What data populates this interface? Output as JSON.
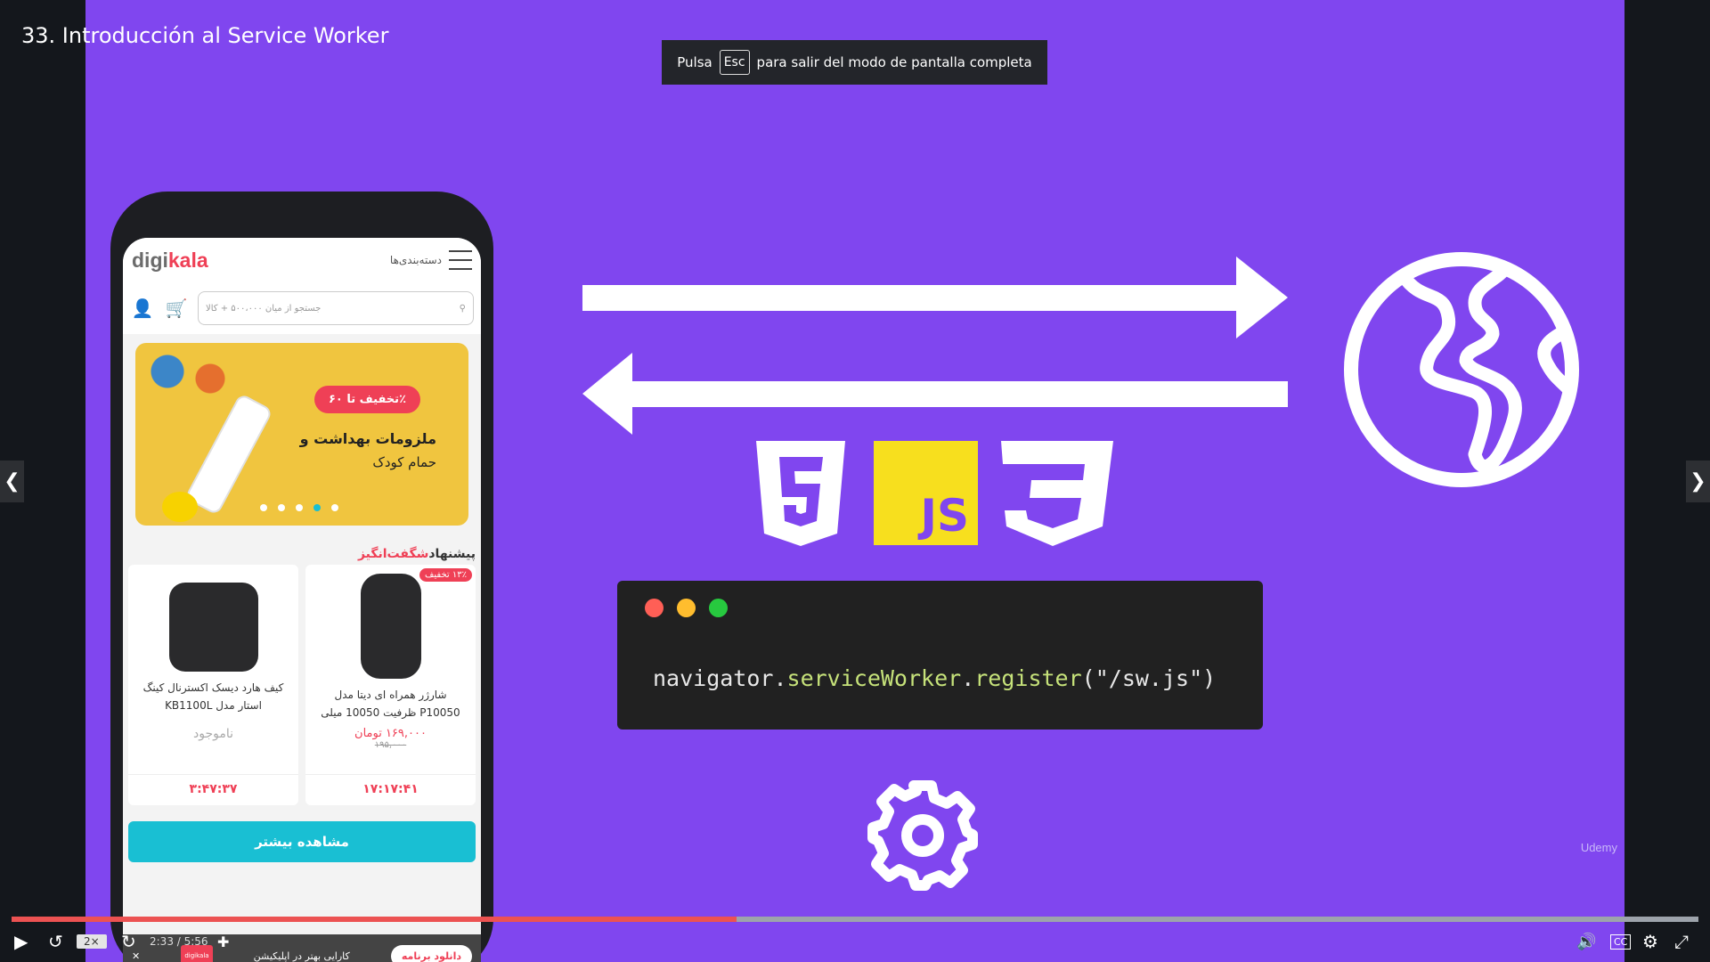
{
  "lecture": {
    "title": "33. Introducción al Service Worker"
  },
  "fullscreen_banner": {
    "pre": "Pulsa",
    "key": "Esc",
    "post": "para salir del modo de pantalla completa"
  },
  "nav": {
    "prev_icon": "chevron-left-icon",
    "next_icon": "chevron-right-icon"
  },
  "phone": {
    "logo_main": "digi",
    "logo_accent": "kala",
    "categories_label": "دسته‌بندی‌ها",
    "search_placeholder": "جستجو از میان ۵۰۰،۰۰۰ + کالا",
    "banner": {
      "badge": "تخفیف تا ۶۰٪",
      "line1": "ملزومات بهداشت و",
      "line2": "حمام کودک"
    },
    "amazing_prefix": "پیشنهاد",
    "amazing_accent": "شگفت‌انگیز",
    "products": [
      {
        "name": "شارژر همراه ای دیتا مدل P10050 ظرفیت 10050 میلی",
        "price": "۱۶۹,۰۰۰ تومان",
        "old_price": "۱۹۵,۰۰۰",
        "off": "۱۳٪ تخفیف",
        "timer": "۱۷:۱۷:۴۱"
      },
      {
        "name": "کیف هارد دیسک اکسترنال کینگ استار مدل KB1100L",
        "status": "ناموجود",
        "timer": "۳:۴۷:۳۷"
      }
    ],
    "more_button": "مشاهده بیشتر",
    "app_bar": {
      "download": "دانلود برنامه",
      "tagline": "کارایی بهتر در اپلیکیشن",
      "logo": "digikala"
    }
  },
  "diagram": {
    "code_line_prefix": "navigator.",
    "code_hl1": "serviceWorker",
    "code_mid": ".",
    "code_hl2": "register",
    "code_suffix": "(\"/sw.js\")",
    "js_label": "JS",
    "watermark": "Udemy",
    "colors": {
      "bg": "#8046ef",
      "code_bg": "#212121",
      "red": "#ff5f56",
      "yellow": "#ffbd2e",
      "green": "#27c93f",
      "highlight": "#c6e27a",
      "js": "#f7df1e"
    }
  },
  "player": {
    "progress": 0.43,
    "speed": "2×",
    "time": "2:33 / 5:56",
    "colors": {
      "progress": "#ec5252",
      "track": "#9da3ab"
    }
  }
}
